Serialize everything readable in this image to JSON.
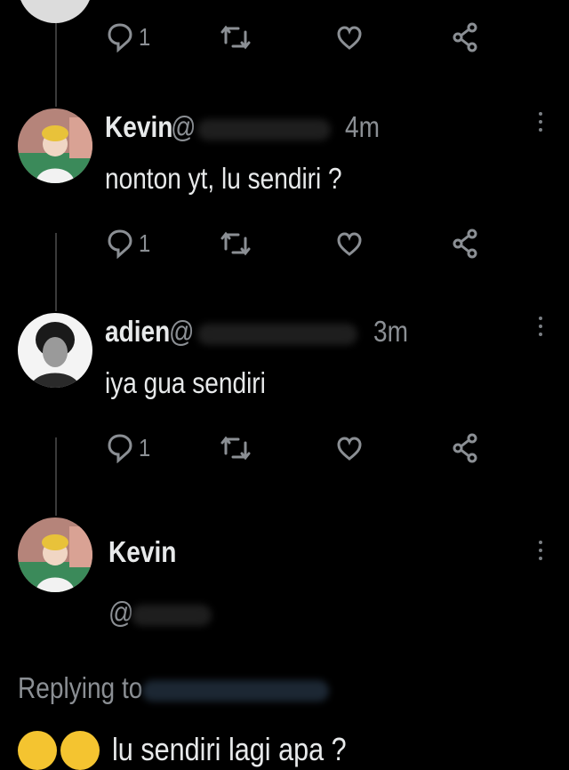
{
  "colors": {
    "background": "#000000",
    "text": "#e7e9ea",
    "muted": "#8b8f94"
  },
  "top_actions": {
    "reply_count": "1"
  },
  "tweets": [
    {
      "name": "Kevin",
      "handle": "@",
      "time": "4m",
      "text": "nonton yt, lu sendiri ?",
      "reply_count": "1"
    },
    {
      "name": "adien",
      "handle": "@",
      "time": "3m",
      "text": "iya gua sendiri",
      "reply_count": "1"
    }
  ],
  "main_tweet": {
    "name": "Kevin",
    "handle": "@",
    "replying_to_label": "Replying to",
    "text": "lu sendiri lagi apa ?"
  },
  "icons": [
    "reply-icon",
    "retweet-icon",
    "like-icon",
    "share-icon",
    "more-icon"
  ]
}
